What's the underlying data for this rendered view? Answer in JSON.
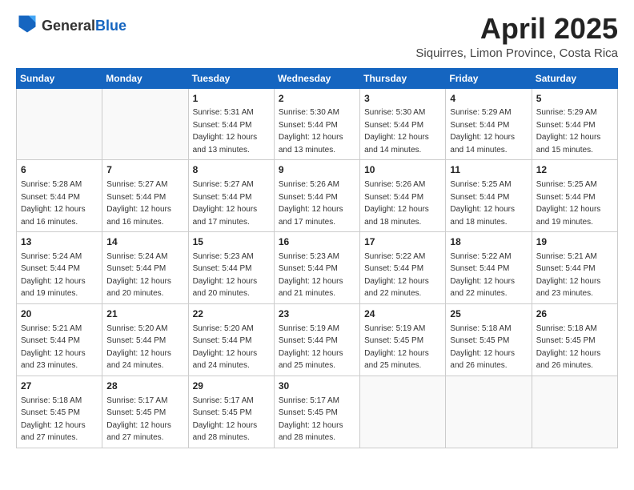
{
  "logo": {
    "general": "General",
    "blue": "Blue"
  },
  "header": {
    "month": "April 2025",
    "location": "Siquirres, Limon Province, Costa Rica"
  },
  "weekdays": [
    "Sunday",
    "Monday",
    "Tuesday",
    "Wednesday",
    "Thursday",
    "Friday",
    "Saturday"
  ],
  "weeks": [
    [
      {
        "day": "",
        "sunrise": "",
        "sunset": "",
        "daylight": ""
      },
      {
        "day": "",
        "sunrise": "",
        "sunset": "",
        "daylight": ""
      },
      {
        "day": "1",
        "sunrise": "Sunrise: 5:31 AM",
        "sunset": "Sunset: 5:44 PM",
        "daylight": "Daylight: 12 hours and 13 minutes."
      },
      {
        "day": "2",
        "sunrise": "Sunrise: 5:30 AM",
        "sunset": "Sunset: 5:44 PM",
        "daylight": "Daylight: 12 hours and 13 minutes."
      },
      {
        "day": "3",
        "sunrise": "Sunrise: 5:30 AM",
        "sunset": "Sunset: 5:44 PM",
        "daylight": "Daylight: 12 hours and 14 minutes."
      },
      {
        "day": "4",
        "sunrise": "Sunrise: 5:29 AM",
        "sunset": "Sunset: 5:44 PM",
        "daylight": "Daylight: 12 hours and 14 minutes."
      },
      {
        "day": "5",
        "sunrise": "Sunrise: 5:29 AM",
        "sunset": "Sunset: 5:44 PM",
        "daylight": "Daylight: 12 hours and 15 minutes."
      }
    ],
    [
      {
        "day": "6",
        "sunrise": "Sunrise: 5:28 AM",
        "sunset": "Sunset: 5:44 PM",
        "daylight": "Daylight: 12 hours and 16 minutes."
      },
      {
        "day": "7",
        "sunrise": "Sunrise: 5:27 AM",
        "sunset": "Sunset: 5:44 PM",
        "daylight": "Daylight: 12 hours and 16 minutes."
      },
      {
        "day": "8",
        "sunrise": "Sunrise: 5:27 AM",
        "sunset": "Sunset: 5:44 PM",
        "daylight": "Daylight: 12 hours and 17 minutes."
      },
      {
        "day": "9",
        "sunrise": "Sunrise: 5:26 AM",
        "sunset": "Sunset: 5:44 PM",
        "daylight": "Daylight: 12 hours and 17 minutes."
      },
      {
        "day": "10",
        "sunrise": "Sunrise: 5:26 AM",
        "sunset": "Sunset: 5:44 PM",
        "daylight": "Daylight: 12 hours and 18 minutes."
      },
      {
        "day": "11",
        "sunrise": "Sunrise: 5:25 AM",
        "sunset": "Sunset: 5:44 PM",
        "daylight": "Daylight: 12 hours and 18 minutes."
      },
      {
        "day": "12",
        "sunrise": "Sunrise: 5:25 AM",
        "sunset": "Sunset: 5:44 PM",
        "daylight": "Daylight: 12 hours and 19 minutes."
      }
    ],
    [
      {
        "day": "13",
        "sunrise": "Sunrise: 5:24 AM",
        "sunset": "Sunset: 5:44 PM",
        "daylight": "Daylight: 12 hours and 19 minutes."
      },
      {
        "day": "14",
        "sunrise": "Sunrise: 5:24 AM",
        "sunset": "Sunset: 5:44 PM",
        "daylight": "Daylight: 12 hours and 20 minutes."
      },
      {
        "day": "15",
        "sunrise": "Sunrise: 5:23 AM",
        "sunset": "Sunset: 5:44 PM",
        "daylight": "Daylight: 12 hours and 20 minutes."
      },
      {
        "day": "16",
        "sunrise": "Sunrise: 5:23 AM",
        "sunset": "Sunset: 5:44 PM",
        "daylight": "Daylight: 12 hours and 21 minutes."
      },
      {
        "day": "17",
        "sunrise": "Sunrise: 5:22 AM",
        "sunset": "Sunset: 5:44 PM",
        "daylight": "Daylight: 12 hours and 22 minutes."
      },
      {
        "day": "18",
        "sunrise": "Sunrise: 5:22 AM",
        "sunset": "Sunset: 5:44 PM",
        "daylight": "Daylight: 12 hours and 22 minutes."
      },
      {
        "day": "19",
        "sunrise": "Sunrise: 5:21 AM",
        "sunset": "Sunset: 5:44 PM",
        "daylight": "Daylight: 12 hours and 23 minutes."
      }
    ],
    [
      {
        "day": "20",
        "sunrise": "Sunrise: 5:21 AM",
        "sunset": "Sunset: 5:44 PM",
        "daylight": "Daylight: 12 hours and 23 minutes."
      },
      {
        "day": "21",
        "sunrise": "Sunrise: 5:20 AM",
        "sunset": "Sunset: 5:44 PM",
        "daylight": "Daylight: 12 hours and 24 minutes."
      },
      {
        "day": "22",
        "sunrise": "Sunrise: 5:20 AM",
        "sunset": "Sunset: 5:44 PM",
        "daylight": "Daylight: 12 hours and 24 minutes."
      },
      {
        "day": "23",
        "sunrise": "Sunrise: 5:19 AM",
        "sunset": "Sunset: 5:44 PM",
        "daylight": "Daylight: 12 hours and 25 minutes."
      },
      {
        "day": "24",
        "sunrise": "Sunrise: 5:19 AM",
        "sunset": "Sunset: 5:45 PM",
        "daylight": "Daylight: 12 hours and 25 minutes."
      },
      {
        "day": "25",
        "sunrise": "Sunrise: 5:18 AM",
        "sunset": "Sunset: 5:45 PM",
        "daylight": "Daylight: 12 hours and 26 minutes."
      },
      {
        "day": "26",
        "sunrise": "Sunrise: 5:18 AM",
        "sunset": "Sunset: 5:45 PM",
        "daylight": "Daylight: 12 hours and 26 minutes."
      }
    ],
    [
      {
        "day": "27",
        "sunrise": "Sunrise: 5:18 AM",
        "sunset": "Sunset: 5:45 PM",
        "daylight": "Daylight: 12 hours and 27 minutes."
      },
      {
        "day": "28",
        "sunrise": "Sunrise: 5:17 AM",
        "sunset": "Sunset: 5:45 PM",
        "daylight": "Daylight: 12 hours and 27 minutes."
      },
      {
        "day": "29",
        "sunrise": "Sunrise: 5:17 AM",
        "sunset": "Sunset: 5:45 PM",
        "daylight": "Daylight: 12 hours and 28 minutes."
      },
      {
        "day": "30",
        "sunrise": "Sunrise: 5:17 AM",
        "sunset": "Sunset: 5:45 PM",
        "daylight": "Daylight: 12 hours and 28 minutes."
      },
      {
        "day": "",
        "sunrise": "",
        "sunset": "",
        "daylight": ""
      },
      {
        "day": "",
        "sunrise": "",
        "sunset": "",
        "daylight": ""
      },
      {
        "day": "",
        "sunrise": "",
        "sunset": "",
        "daylight": ""
      }
    ]
  ]
}
